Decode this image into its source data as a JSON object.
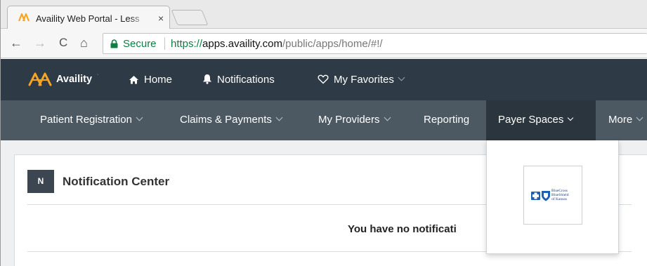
{
  "browser": {
    "tab_title": "Availity Web Portal - Less",
    "tab_close": "×",
    "back": "←",
    "forward": "→",
    "reload": "C",
    "home": "⌂",
    "secure_label": "Secure",
    "url_scheme": "https://",
    "url_host": "apps.availity.com",
    "url_path": "/public/apps/home/#!/"
  },
  "header": {
    "brand_name": "Availity",
    "brand_tm": "·",
    "home_label": "Home",
    "notifications_label": "Notifications",
    "favorites_label": "My Favorites"
  },
  "subnav": {
    "items": [
      {
        "label": "Patient Registration"
      },
      {
        "label": "Claims & Payments"
      },
      {
        "label": "My Providers"
      },
      {
        "label": "Reporting"
      },
      {
        "label": "Payer Spaces"
      },
      {
        "label": "More"
      }
    ]
  },
  "notification_center": {
    "badge": "N",
    "title": "Notification Center",
    "empty_message": "You have no notificati"
  },
  "payer_spaces": {
    "payers": [
      {
        "name_lines": [
          "BlueCross",
          "BlueShield",
          "of Kansas"
        ]
      }
    ]
  },
  "colors": {
    "brand_orange": "#f5a623",
    "header_bg": "#2e3a45",
    "subnav_bg": "#4c5963",
    "secure_green": "#0b8043",
    "bcbs_blue": "#1f5fb0"
  }
}
